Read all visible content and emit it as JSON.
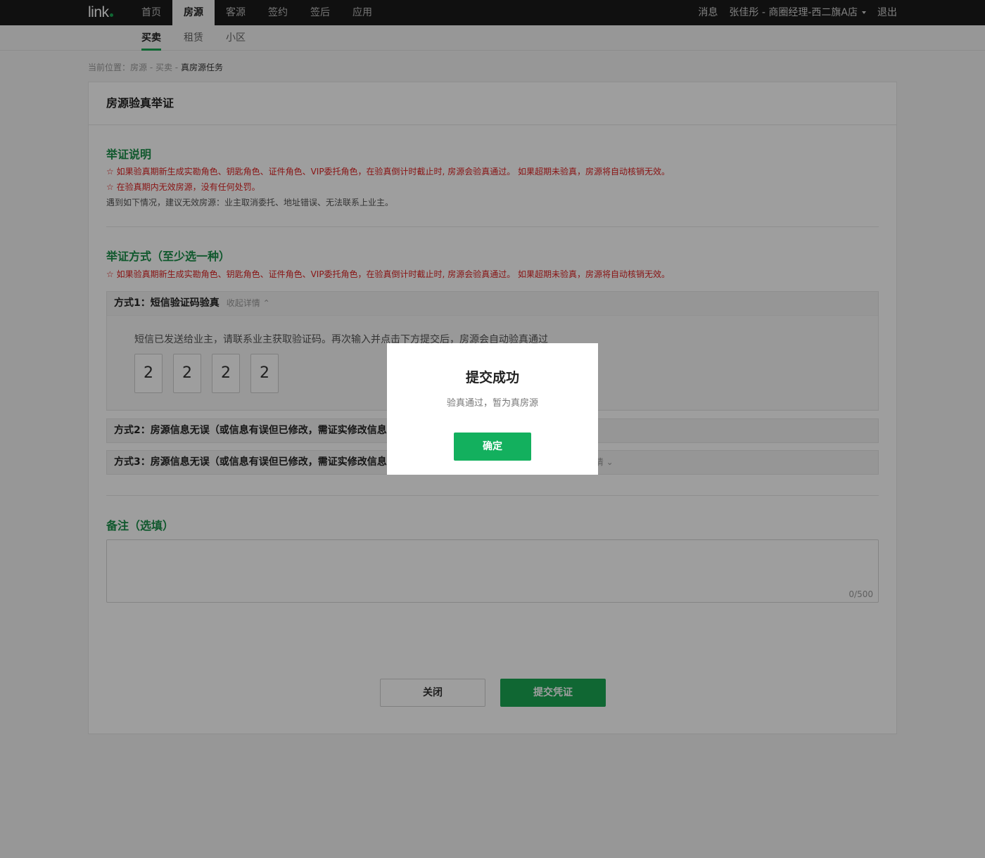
{
  "colors": {
    "brand": "#1aa653",
    "accent_red": "#dd2222",
    "topbar": "#1b1b1b"
  },
  "topbar": {
    "logo": "link",
    "nav": [
      "首页",
      "房源",
      "客源",
      "签约",
      "签后",
      "应用"
    ],
    "active_nav": "房源",
    "messages": "消息",
    "user": "张佳彤 - 商圈经理-西二旗A店",
    "logout": "退出"
  },
  "subnav": {
    "items": [
      "买卖",
      "租赁",
      "小区"
    ],
    "active": "买卖"
  },
  "breadcrumb": {
    "prefix": "当前位置：",
    "path": "房源 - 买卖 - ",
    "current": "真房源任务"
  },
  "card": {
    "title": "房源验真举证",
    "explain": {
      "title": "举证说明",
      "line1": "☆ 如果验真期新生成实勘角色、钥匙角色、证件角色、VIP委托角色，在验真倒计时截止时, 房源会验真通过。 如果超期未验真，房源将自动核销无效。",
      "line2": "☆ 在验真期内无效房源，没有任何处罚。",
      "line3": "遇到如下情况，建议无效房源：业主取消委托、地址错误、无法联系上业主。"
    },
    "methods": {
      "title": "举证方式（至少选一种）",
      "note": "☆ 如果验真期新生成实勘角色、钥匙角色、证件角色、VIP委托角色，在验真倒计时截止时, 房源会验真通过。 如果超期未验真，房源将自动核销无效。",
      "m1": {
        "title": "方式1：短信验证码验真",
        "toggle": "收起详情 ⌃",
        "desc": "短信已发送给业主，请联系业主获取验证码。再次输入并点击下方提交后，房源会自动验真通过",
        "code": [
          "2",
          "2",
          "2",
          "2"
        ]
      },
      "m2": {
        "title": "方式2：房源信息无误（或信息有误但已修改，需证实修改信息"
      },
      "m3": {
        "title": "方式3：房源信息无误（或信息有误但已修改，需证实修改信息",
        "toggle": "开详情 ⌄"
      }
    },
    "remark": {
      "title": "备注（选填）",
      "counter": "0/500"
    },
    "buttons": {
      "close": "关闭",
      "submit": "提交凭证"
    }
  },
  "modal": {
    "title": "提交成功",
    "message": "验真通过，暂为真房源",
    "confirm": "确定"
  }
}
